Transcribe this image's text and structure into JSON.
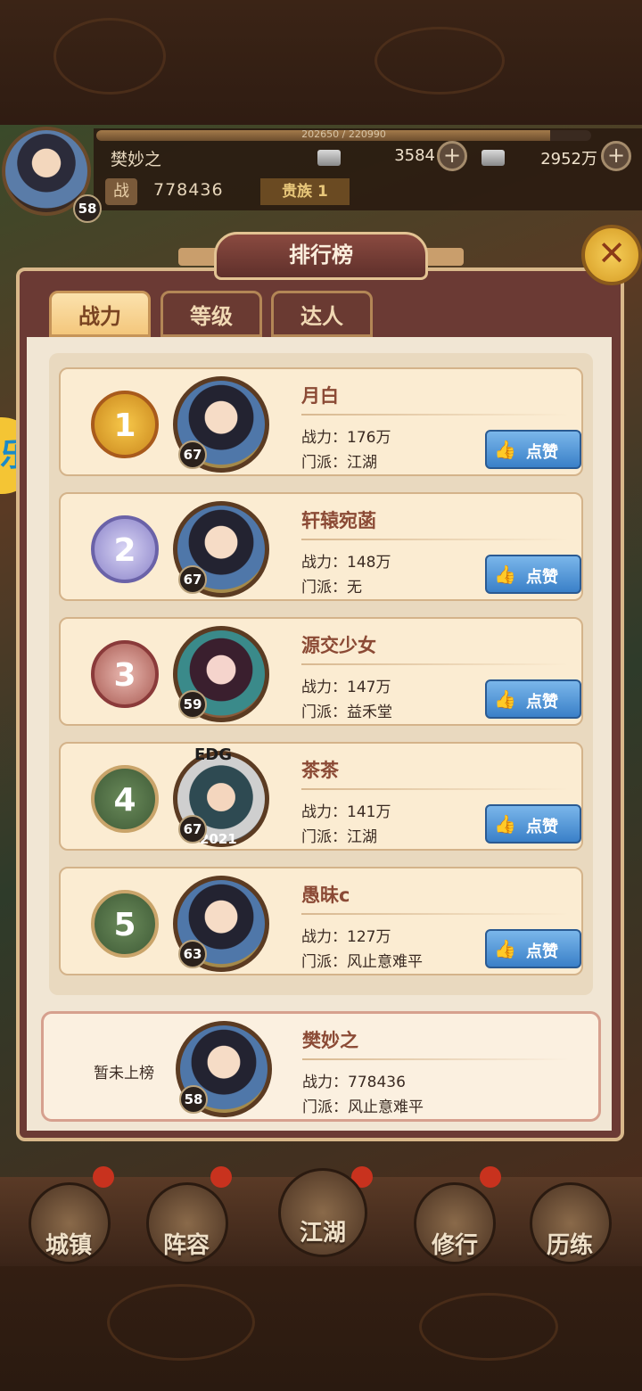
{
  "player": {
    "exp_text": "202650 / 220990",
    "exp_fraction": 0.917,
    "name": "樊妙之",
    "level": "58",
    "silver": "3584",
    "coins": "2952万",
    "power_label": "战",
    "power": "778436",
    "noble": "贵族 1"
  },
  "panel": {
    "title": "排行榜",
    "close_icon": "close-x-icon",
    "tabs": [
      {
        "label": "战力",
        "active": true
      },
      {
        "label": "等级",
        "active": false
      },
      {
        "label": "达人",
        "active": false
      }
    ]
  },
  "labels": {
    "power_prefix": "战力：",
    "sect_prefix": "门派：",
    "like": "点赞",
    "unranked": "暂未上榜"
  },
  "ranking": [
    {
      "rank": "1",
      "name": "月白",
      "level": "67",
      "power": "176万",
      "sect": "江湖"
    },
    {
      "rank": "2",
      "name": "轩辕宛菡",
      "level": "67",
      "power": "148万",
      "sect": "无"
    },
    {
      "rank": "3",
      "name": "源交少女",
      "level": "59",
      "power": "147万",
      "sect": "益禾堂"
    },
    {
      "rank": "4",
      "name": "茶茶",
      "level": "67",
      "power": "141万",
      "sect": "江湖"
    },
    {
      "rank": "5",
      "name": "愚昧c",
      "level": "63",
      "power": "127万",
      "sect": "风止意难平"
    }
  ],
  "avatar_badge": {
    "top": "EDG",
    "bottom": "2021"
  },
  "self": {
    "name": "樊妙之",
    "level": "58",
    "power": "778436",
    "sect": "风止意难平"
  },
  "side_tag": "乐",
  "nav": [
    {
      "label": "城镇"
    },
    {
      "label": "阵容"
    },
    {
      "label": "江湖"
    },
    {
      "label": "修行"
    },
    {
      "label": "历练"
    }
  ],
  "colors": {
    "panel": "#6b3a34",
    "accent_gold": "#f4c77c",
    "like_button": "#3a80c8",
    "name_text": "#8b4a35"
  }
}
